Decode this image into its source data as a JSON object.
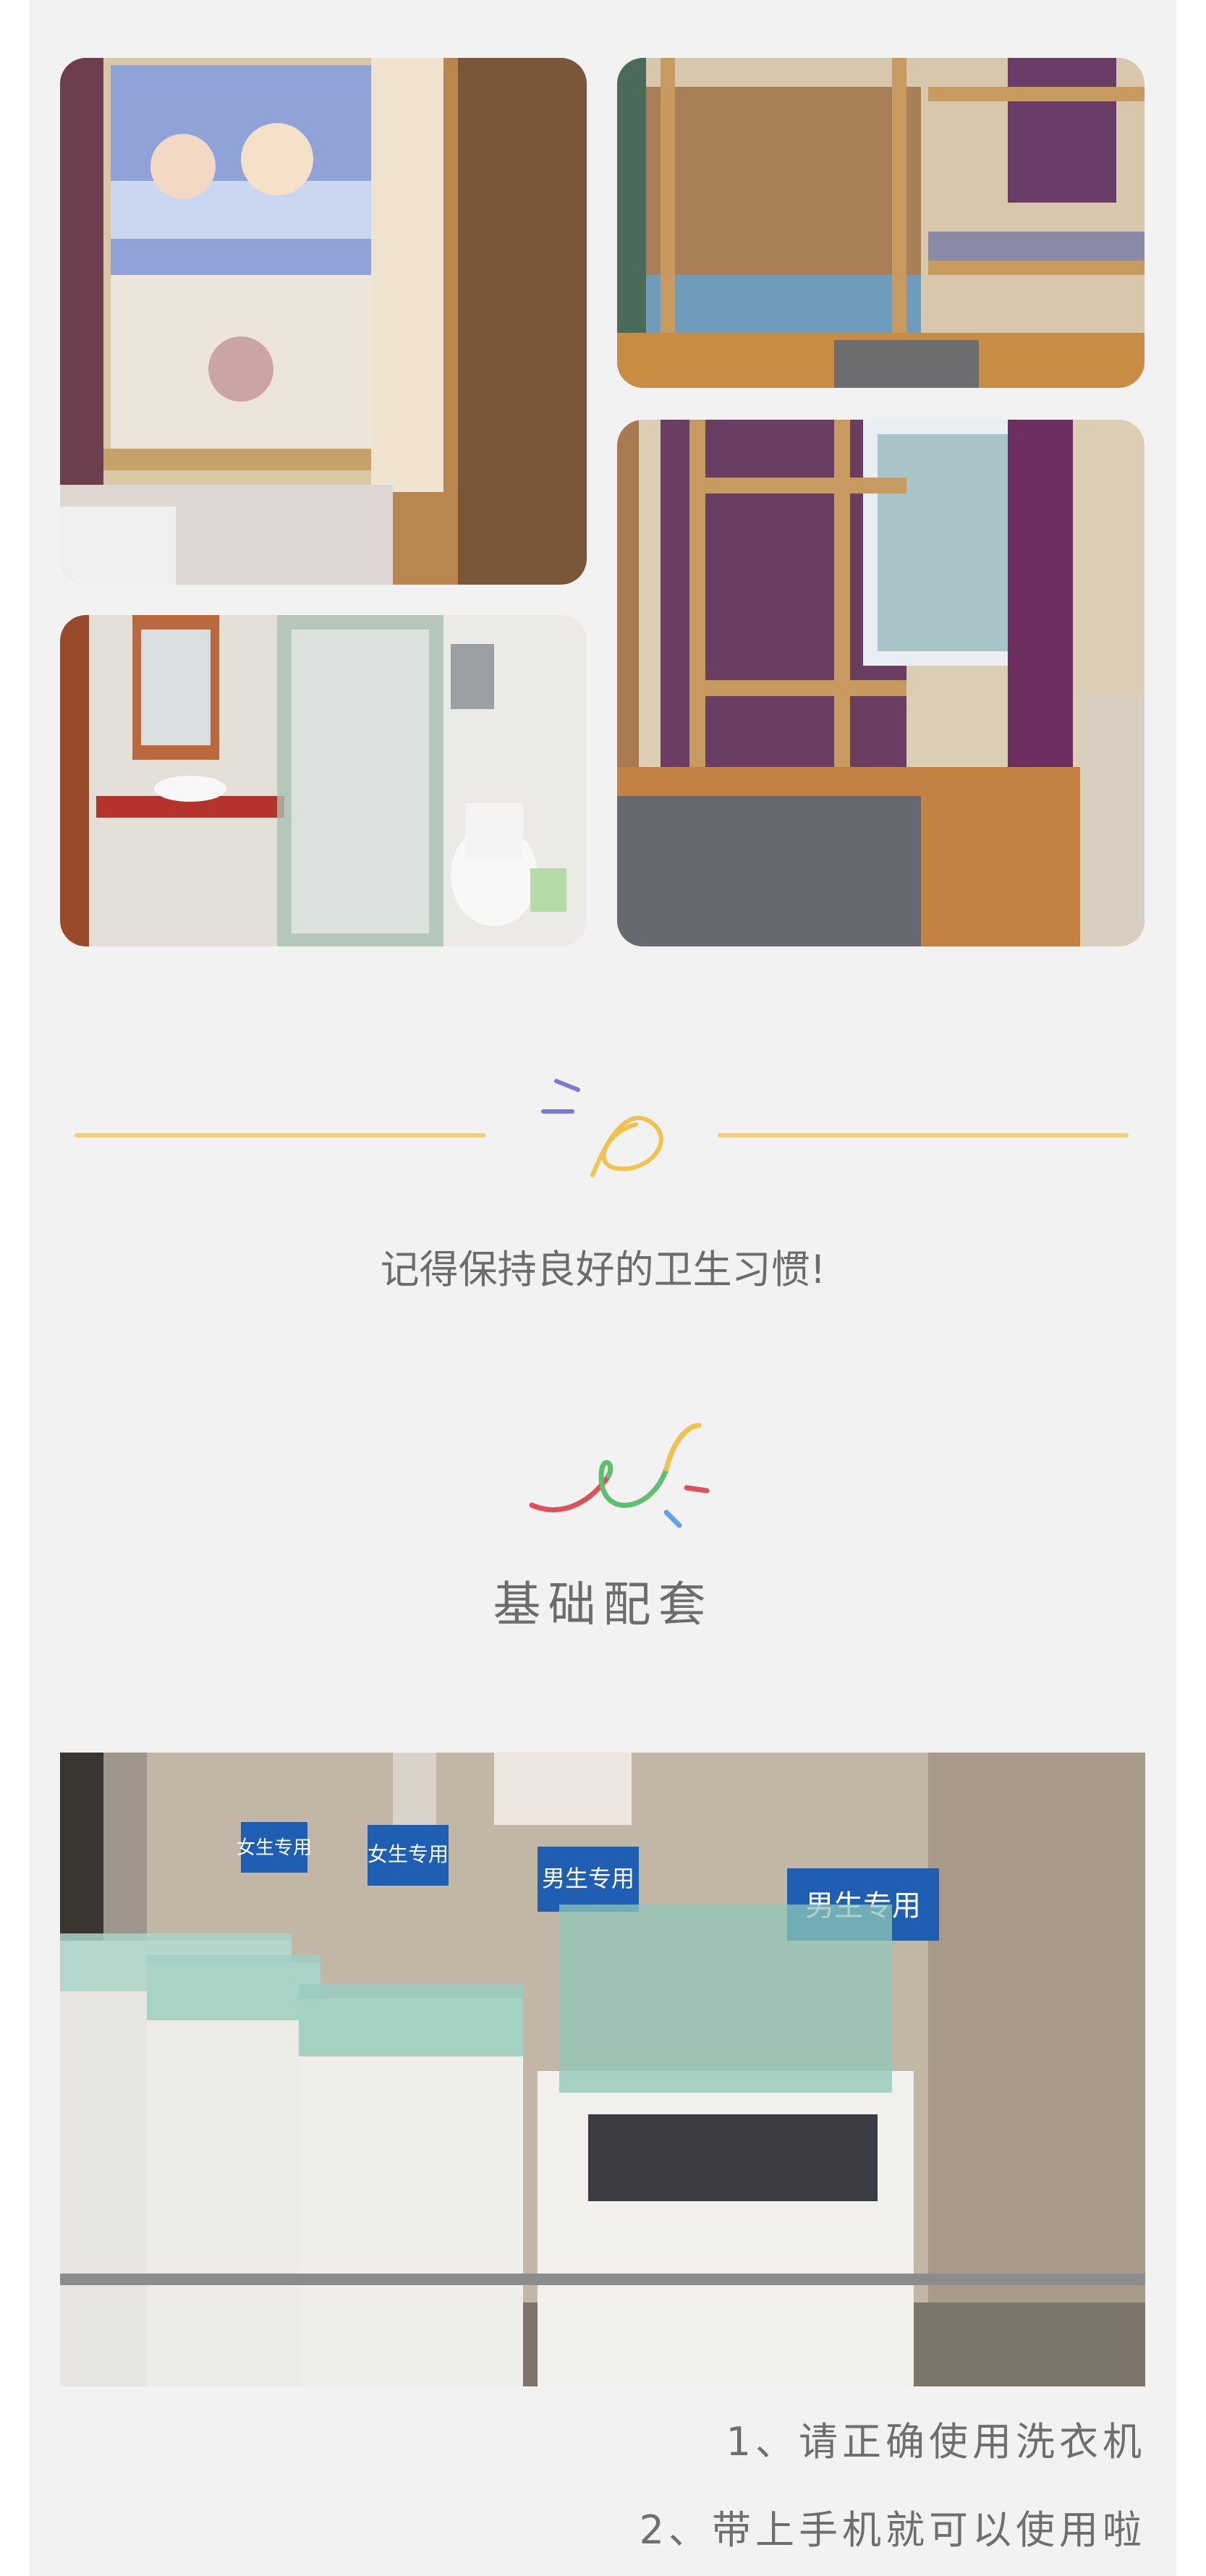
{
  "photos": {
    "curtained_bed": "curtained bunk bed with cartoon curtains and fluffy rug",
    "dorm_room_small": "dorm room with wooden bunk beds and purple curtains",
    "dorm_room_window": "dorm room with bunk beds near window, grey rug",
    "bathroom": "bathroom with sink, shower stall and toilet",
    "laundry": "row of coin washing machines with signs"
  },
  "hygiene_text": "记得保持良好的卫生习惯!",
  "section_title": "基础配套",
  "laundry_signs": [
    "女生专用",
    "女生专用",
    "男生专用",
    "男生专用"
  ],
  "notes": [
    "1、请正确使用洗衣机",
    "2、带上手机就可以使用啦"
  ],
  "colors": {
    "page_bg": "#f2f2f2",
    "divider": "#f7cf73",
    "text": "#6c6c6c",
    "accent_purple": "#7a7ad6",
    "accent_red": "#e0505a",
    "accent_green": "#5fbf6f",
    "accent_blue": "#59a6e8",
    "accent_yellow": "#f2c14e"
  }
}
